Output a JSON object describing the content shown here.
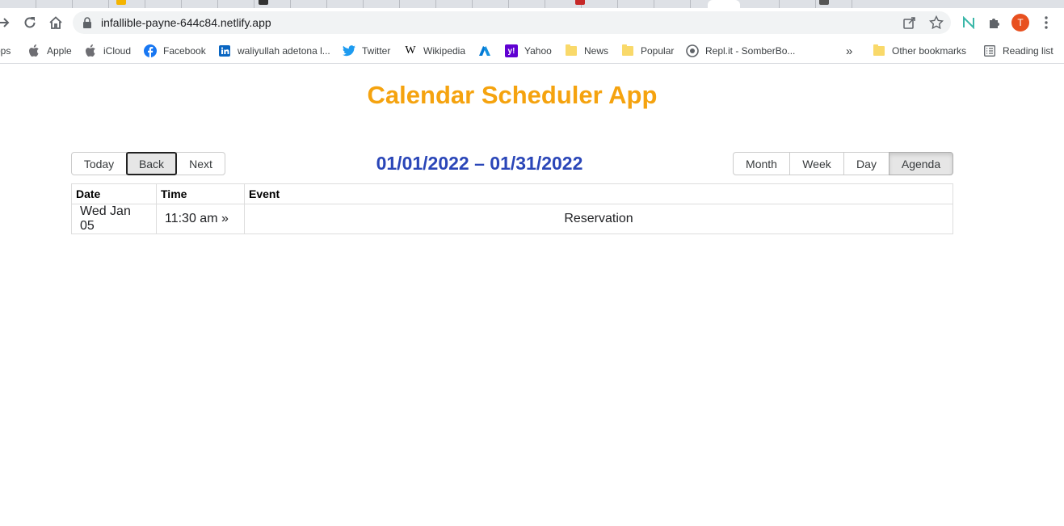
{
  "browser": {
    "url": "infallible-payne-644c84.netlify.app",
    "avatar_letter": "T",
    "bookmarks": [
      {
        "label": "ops",
        "icon": "apps-icon"
      },
      {
        "label": "Apple",
        "icon": "apple-icon"
      },
      {
        "label": "iCloud",
        "icon": "apple-icon"
      },
      {
        "label": "Facebook",
        "icon": "facebook-icon"
      },
      {
        "label": "waliyullah adetona l...",
        "icon": "linkedin-icon"
      },
      {
        "label": "Twitter",
        "icon": "twitter-icon"
      },
      {
        "label": "Wikipedia",
        "icon": "wikipedia-icon"
      },
      {
        "label": "",
        "icon": "azure-icon"
      },
      {
        "label": "Yahoo",
        "icon": "yahoo-icon"
      },
      {
        "label": "News",
        "icon": "folder-icon"
      },
      {
        "label": "Popular",
        "icon": "folder-icon"
      },
      {
        "label": "Repl.it - SomberBo...",
        "icon": "replit-icon"
      }
    ],
    "overflow_label": "»",
    "other_bookmarks": "Other bookmarks",
    "reading_list": "Reading list"
  },
  "page": {
    "title": "Calendar Scheduler App",
    "nav_buttons": [
      "Today",
      "Back",
      "Next"
    ],
    "range_label": "01/01/2022 – 01/31/2022",
    "view_buttons": [
      "Month",
      "Week",
      "Day",
      "Agenda"
    ],
    "active_view": "Agenda",
    "agenda": {
      "headers": {
        "date": "Date",
        "time": "Time",
        "event": "Event"
      },
      "rows": [
        {
          "date": "Wed Jan 05",
          "time": "11:30 am »",
          "event": "Reservation"
        }
      ]
    }
  },
  "colors": {
    "title": "#f5a30f",
    "range_label": "#2a46b8",
    "avatar": "#e8501f"
  }
}
